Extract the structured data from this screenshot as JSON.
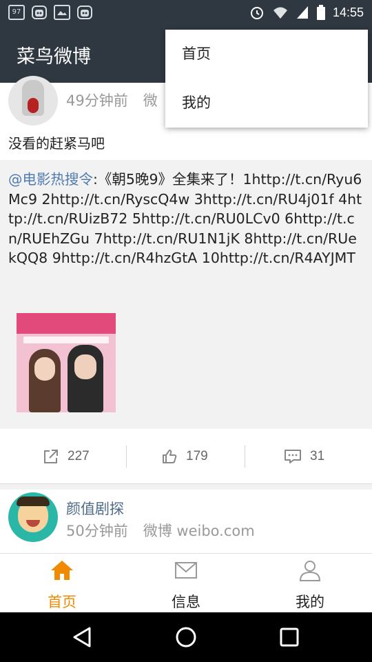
{
  "status_bar": {
    "left_icons": [
      "notification-97-icon",
      "robot-icon",
      "image-icon",
      "robot-icon"
    ],
    "left_icon_text": "97",
    "right_icons": [
      "alarm-icon",
      "wifi-icon",
      "signal-icon",
      "battery-icon"
    ],
    "time": "14:55"
  },
  "app_bar": {
    "title": "菜鸟微博"
  },
  "menu": {
    "items": [
      {
        "label": "首页"
      },
      {
        "label": "我的"
      }
    ]
  },
  "post1": {
    "time": "49分钟前",
    "source": "微",
    "text": "没看的赶紧马吧",
    "repost": {
      "mention": "@电影热搜令",
      "body": ":《朝5晚9》全集来了！1http://t.cn/Ryu6Mc9 2http://t.cn/RyscQ4w 3http://t.cn/RU4j01f 4http://t.cn/RUizB72 5http://t.cn/RU0LCv0 6http://t.cn/RUEhZGu 7http://t.cn/RU1N1jK 8http://t.cn/RUekQQ8 9http://t.cn/R4hzGtA 10http://t.cn/R4AYJMT"
    },
    "actions": {
      "repost_count": "227",
      "like_count": "179",
      "comment_count": "31"
    }
  },
  "post2": {
    "name": "颜值剧探",
    "time": "50分钟前",
    "source": "微博 weibo.com"
  },
  "bottom_nav": {
    "items": [
      {
        "label": "首页",
        "icon": "home-icon",
        "active": true
      },
      {
        "label": "信息",
        "icon": "mail-icon",
        "active": false
      },
      {
        "label": "我的",
        "icon": "person-icon",
        "active": false
      }
    ]
  },
  "colors": {
    "app_bar": "#2f3841",
    "accent": "#f08a00",
    "link": "#4f7bb1"
  }
}
